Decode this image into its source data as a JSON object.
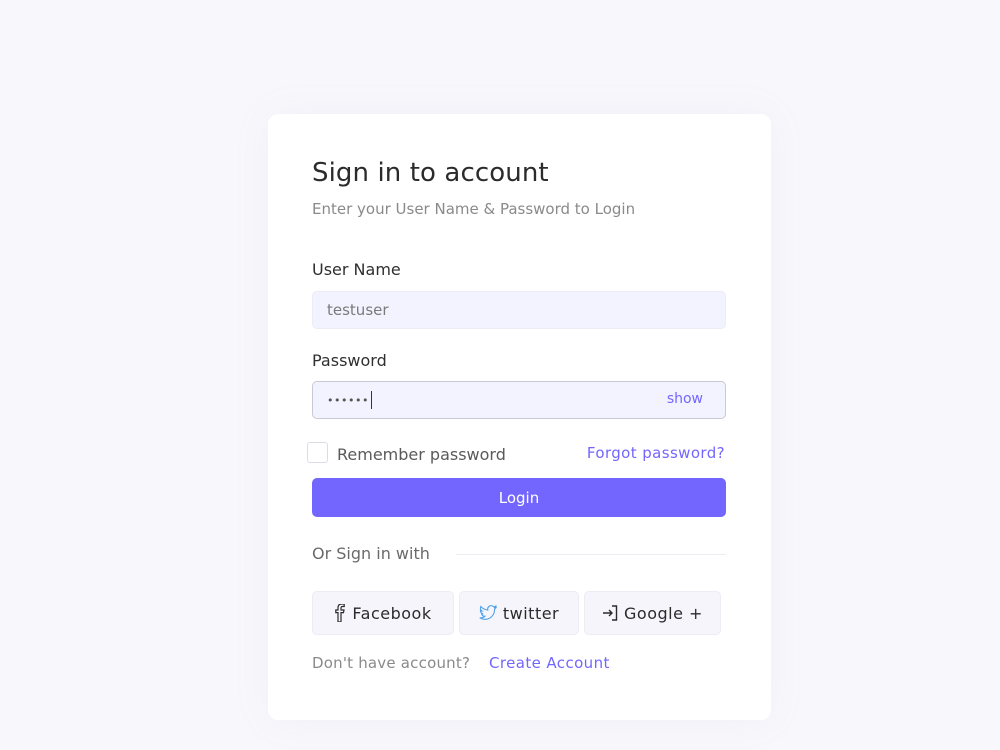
{
  "colors": {
    "accent": "#7366ff",
    "background": "#f8f8fc",
    "card": "#ffffff",
    "input_bg": "#f3f3ff"
  },
  "login": {
    "title": "Sign in to account",
    "subtitle": "Enter your User Name & Password to Login",
    "username_label": "User Name",
    "username_value": "testuser",
    "password_label": "Password",
    "password_value": "••••••",
    "show_label": "show",
    "remember_label": "Remember password",
    "remember_checked": false,
    "forgot_label": "Forgot password?",
    "login_button": "Login",
    "or_sign_in": "Or Sign in with",
    "social": [
      {
        "label": "Facebook",
        "icon": "facebook-icon"
      },
      {
        "label": "twitter",
        "icon": "twitter-icon"
      },
      {
        "label": "Google +",
        "icon": "sign-in-icon"
      }
    ],
    "no_account": "Don't have account?",
    "create_account": "Create Account"
  }
}
